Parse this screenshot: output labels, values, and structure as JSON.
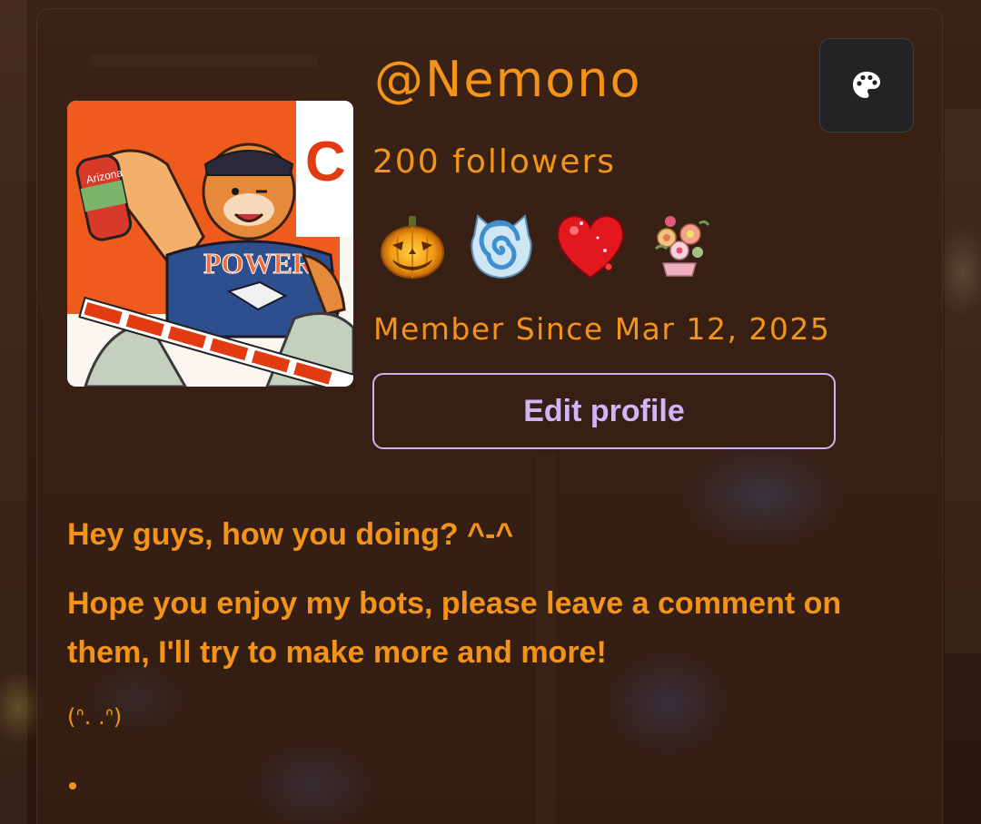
{
  "profile": {
    "username": "@Nemono",
    "followers": "200 followers",
    "member_since": "Member Since Mar 12, 2025",
    "edit_label": "Edit profile",
    "avatar_text": {
      "shirt": "POWER",
      "can": "Arizona",
      "corner": "C"
    }
  },
  "badges": [
    {
      "icon": "jack-o-lantern-icon"
    },
    {
      "icon": "blue-spiral-cat-icon"
    },
    {
      "icon": "sparkly-heart-icon"
    },
    {
      "icon": "flower-bouquet-icon"
    }
  ],
  "theme_button": {
    "icon": "palette-icon"
  },
  "bio": {
    "line1": "Hey guys, how you doing? ^-^",
    "line2": "Hope you enjoy my bots, please leave a comment on them, I'll try to make more and more!",
    "kaomoji": "(ᐢ. .ᐢ)",
    "bullet": "•"
  },
  "colors": {
    "accent": "#f39419",
    "button_border": "#cdb2ec",
    "button_text": "#d2b5f5",
    "theme_button_bg": "#232326"
  }
}
